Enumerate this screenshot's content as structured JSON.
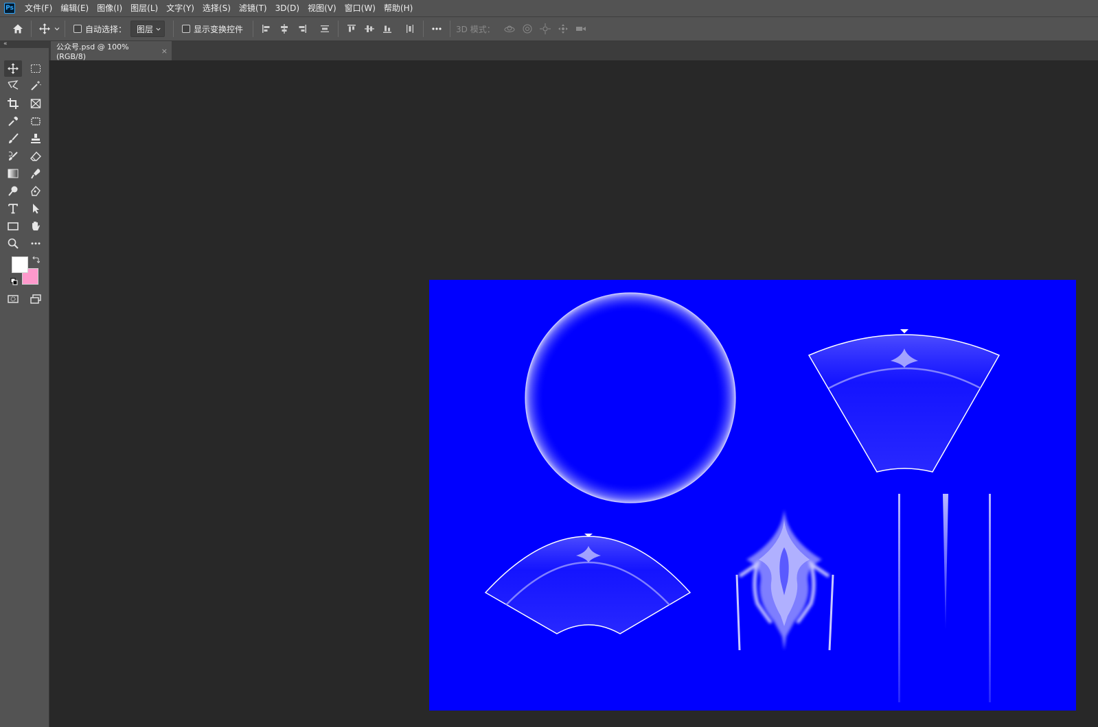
{
  "app": {
    "logo_text": "Ps"
  },
  "menu": [
    "文件(F)",
    "编辑(E)",
    "图像(I)",
    "图层(L)",
    "文字(Y)",
    "选择(S)",
    "滤镜(T)",
    "3D(D)",
    "视图(V)",
    "窗口(W)",
    "帮助(H)"
  ],
  "options": {
    "auto_select_label": "自动选择：",
    "auto_select_value": "图层",
    "show_transform_label": "显示变换控件",
    "mode_3d_label": "3D 模式："
  },
  "document": {
    "tab_title": "公众号.psd @ 100%(RGB/8)",
    "close_symbol": "×"
  },
  "colors": {
    "foreground": "#ffffff",
    "background": "#ff99cc",
    "canvas": "#0000ff"
  },
  "tools": [
    [
      "move-icon",
      "marquee-icon"
    ],
    [
      "lasso-icon",
      "magic-wand-icon"
    ],
    [
      "crop-icon",
      "frame-icon"
    ],
    [
      "eyedropper-icon",
      "patch-icon"
    ],
    [
      "brush-icon",
      "stamp-icon"
    ],
    [
      "history-brush-icon",
      "eraser-icon"
    ],
    [
      "gradient-icon",
      "smudge-icon"
    ],
    [
      "dodge-icon",
      "pen-icon"
    ],
    [
      "type-icon",
      "path-select-icon"
    ],
    [
      "rectangle-icon",
      "hand-icon"
    ],
    [
      "zoom-icon",
      "more-tools-icon"
    ]
  ]
}
